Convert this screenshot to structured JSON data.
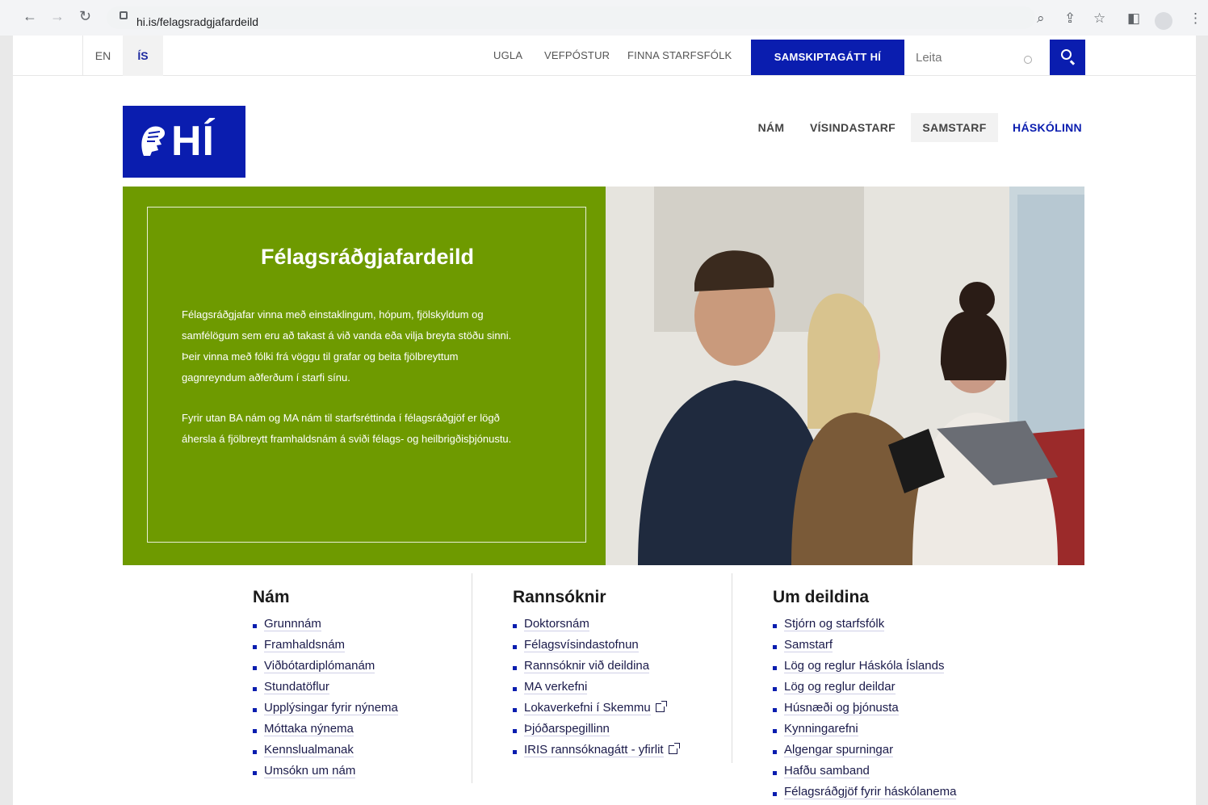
{
  "browser": {
    "url": "hi.is/felagsradgjafardeild"
  },
  "utility": {
    "lang_en": "EN",
    "lang_is": "ÍS",
    "links": [
      "UGLA",
      "VEFPÓSTUR",
      "FINNA STARFSFÓLK"
    ],
    "portal": "SAMSKIPTAGÁTT HÍ",
    "search_placeholder": "Leita"
  },
  "logo": {
    "text": "HÍ"
  },
  "mainnav": [
    "NÁM",
    "VÍSINDASTARF",
    "SAMSTARF",
    "HÁSKÓLINN"
  ],
  "hero": {
    "title": "Félagsráðgjafardeild",
    "paragraph1_lines": [
      "Félagsráðgjafar vinna með einstaklingum, hópum, fjölskyldum og",
      "samfélögum sem eru að takast á við vanda eða vilja breyta stöðu sinni.",
      "Þeir vinna með fólki frá vöggu til grafar og beita fjölbreyttum",
      "gagnreyndum aðferðum í starfi sínu."
    ],
    "paragraph2_lines": [
      "Fyrir utan BA nám og  MA nám til starfsréttinda í félagsráðgjöf er lögð",
      "áhersla á fjölbreytt framhaldsnám á sviði félags- og heilbrigðisþjónustu."
    ]
  },
  "columns": {
    "nam": {
      "title": "Nám",
      "items": [
        "Grunnnám",
        "Framhaldsnám",
        "Viðbótardiplómanám",
        "Stundatöflur",
        "Upplýsingar fyrir nýnema",
        "Móttaka nýnema",
        "Kennslualmanak",
        "Umsókn um nám"
      ]
    },
    "rannsoknir": {
      "title": "Rannsóknir",
      "items": [
        "Doktorsnám",
        "Félagsvísindastofnun",
        "Rannsóknir við deildina",
        "MA verkefni",
        "Lokaverkefni í Skemmu",
        "Þjóðarspegillinn",
        "IRIS rannsóknagátt - yfirlit"
      ]
    },
    "um": {
      "title": "Um deildina",
      "items": [
        "Stjórn og starfsfólk",
        "Samstarf",
        "Lög og reglur Háskóla Íslands",
        "Lög og reglur deildar",
        "Húsnæði og þjónusta",
        "Kynningarefni",
        "Algengar spurningar",
        "Hafðu samband",
        "Félagsráðgjöf fyrir háskólanema"
      ]
    }
  },
  "colors": {
    "brand_blue": "#0a1daf",
    "hero_green": "#6e9a00"
  }
}
